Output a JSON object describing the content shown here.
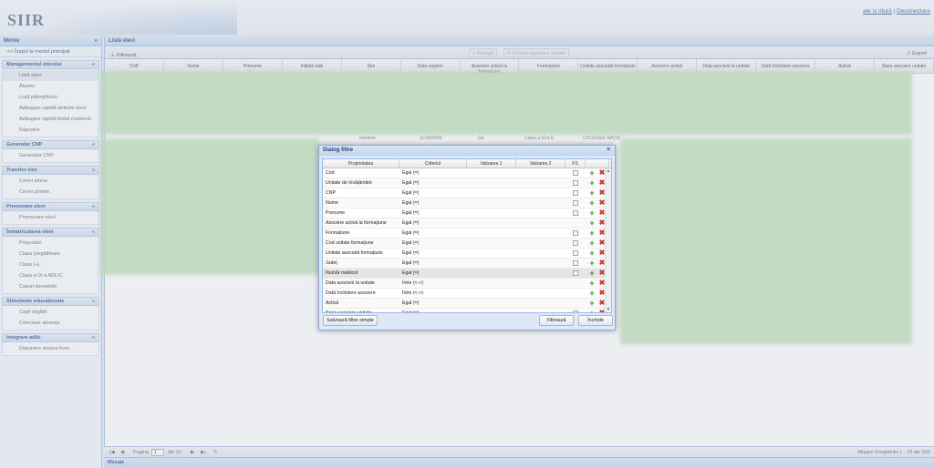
{
  "app": {
    "logo": "SIIR",
    "link_partial": "ale și rituri)",
    "separator": "|",
    "logout": "Deconectare"
  },
  "menu": {
    "title": "Meniu",
    "back": "<< Înapoi la meniul principal",
    "sections": [
      {
        "title": "Managementul elevului",
        "items": [
          "Listă elevi",
          "Alumni",
          "Listă părinți/tutori",
          "Adăugare rapidă atribute elevi",
          "Adăugare rapidă limbă modernă",
          "Rapoarte"
        ]
      },
      {
        "title": "Generator CNP",
        "items": [
          "Generator CNP"
        ]
      },
      {
        "title": "Transfer elev",
        "items": [
          "Cereri emise",
          "Cereri primite"
        ]
      },
      {
        "title": "Promovare elevi",
        "items": [
          "Promovare elevi"
        ]
      },
      {
        "title": "Înmatricularea elevi",
        "items": [
          "Preșcolari",
          "Clasa pregătitoare",
          "Clasa I-a",
          "Clasa a IX-a ADLIC",
          "Cazuri deosebite"
        ]
      },
      {
        "title": "Stimulente educaționale",
        "items": [
          "Copii eligibili",
          "Colectare absențe"
        ]
      },
      {
        "title": "Integrare adlic",
        "items": [
          "Depunere dosare liceu"
        ]
      }
    ]
  },
  "main": {
    "title": "Listă elevi",
    "toolbar": {
      "filter": "Filtrează",
      "add": "Adaugă",
      "close_assoc": "Închide asociere unitate",
      "export": "Export"
    },
    "columns": [
      "CNP",
      "Nume",
      "Prenume",
      "Inițială tată",
      "Sex",
      "Data nașterii",
      "Asociere activă la formațiune",
      "Formațiune",
      "Unitate asociată formațiunii",
      "Asociere activă",
      "Data asocierii la unitate",
      "Dată închidere asociere",
      "Activă",
      "Stare asociere unitate"
    ],
    "visible_row": {
      "sex": "Feminin",
      "birth": "11/10/2005",
      "active": "Da",
      "formation": "Clasa a XI-a E",
      "unit": "COLEGIUL NAȚIC"
    },
    "pager": {
      "page_label": "Pagina",
      "page": "1",
      "of": "din 21",
      "summary": "Afișare înregistrări 1 - 25 din 505"
    },
    "messages": "Mesaje"
  },
  "dialog": {
    "title": "Dialog filtre",
    "columns": [
      "Proprietatea",
      "Criteriul",
      "Valoarea 1",
      "Valoarea 2",
      "FS"
    ],
    "rows": [
      {
        "prop": "Cod",
        "crit": "Egal (=)",
        "fs": true
      },
      {
        "prop": "Unitate de învățământ",
        "crit": "Egal (=)",
        "fs": true
      },
      {
        "prop": "CNP",
        "crit": "Egal (=)",
        "fs": true
      },
      {
        "prop": "Nume",
        "crit": "Egal (=)",
        "fs": true
      },
      {
        "prop": "Prenume",
        "crit": "Egal (=)",
        "fs": true
      },
      {
        "prop": "Asociere activă la formațiune",
        "crit": "Egal (=)",
        "fs": false
      },
      {
        "prop": "Formațiune",
        "crit": "Egal (=)",
        "fs": true
      },
      {
        "prop": "Cod unitate formațiune",
        "crit": "Egal (=)",
        "fs": true
      },
      {
        "prop": "Unitate asociată formațiunii",
        "crit": "Egal (=)",
        "fs": true
      },
      {
        "prop": "Județ",
        "crit": "Egal (=)",
        "fs": true
      },
      {
        "prop": "Număr matricol",
        "crit": "Egal (=)",
        "fs": true
      },
      {
        "prop": "Data asocierii la unitate",
        "crit": "Între (<->)",
        "fs": false
      },
      {
        "prop": "Dată închidere asociere",
        "crit": "Între (<->)",
        "fs": false
      },
      {
        "prop": "Activă",
        "crit": "Egal (=)",
        "fs": false
      },
      {
        "prop": "Stare asociere unitate",
        "crit": "Egal (=)",
        "fs": true
      }
    ],
    "buttons": {
      "save": "Salvează filtre simple",
      "filter": "Filtrează",
      "close": "Închide"
    }
  }
}
